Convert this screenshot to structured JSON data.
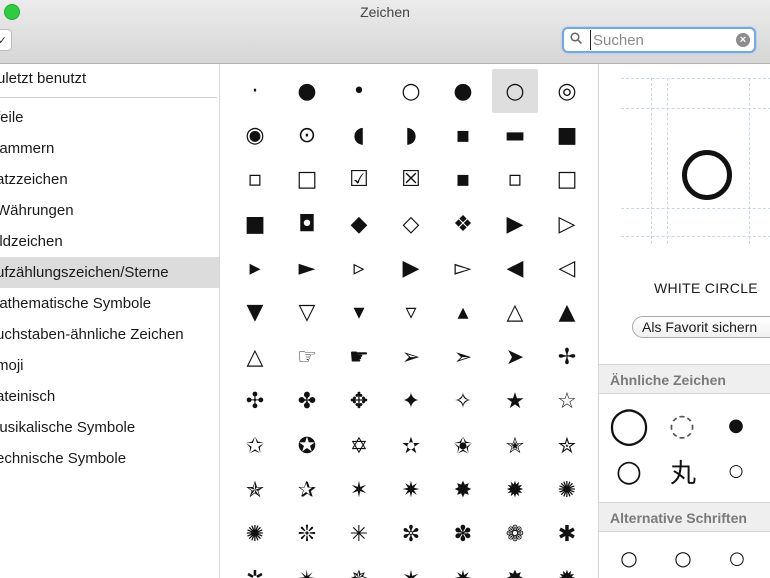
{
  "window": {
    "title": "Zeichen"
  },
  "toolbar": {
    "dropdown_glyph": "✓"
  },
  "search": {
    "placeholder": "Suchen",
    "value": ""
  },
  "sidebar": {
    "recent_label": "uletzt benutzt",
    "categories": [
      "feile",
      "lammern",
      "atzzeichen",
      "Währungen",
      "ildzeichen",
      "ufzählungszeichen/Sterne",
      "lathematische Symbole",
      "uchstaben-ähnliche Zeichen",
      "moji",
      "ateinisch",
      "lusikalische Symbole",
      "echnische Symbole"
    ],
    "selected_index": 5
  },
  "grid": {
    "selected_index": 5,
    "glyphs": [
      "·",
      "●",
      "•",
      "○",
      "●",
      "○",
      "◎",
      "◉",
      "⊙",
      "◖",
      "◗",
      "▪",
      "▬",
      "■",
      "▫",
      "□",
      "☑",
      "☒",
      "▪",
      "▫",
      "□",
      "■",
      "◘",
      "◆",
      "◇",
      "❖",
      "▶",
      "▷",
      "▸",
      "►",
      "▹",
      "▶",
      "▻",
      "◀",
      "◁",
      "▼",
      "▽",
      "▾",
      "▿",
      "▴",
      "△",
      "▲",
      "△",
      "☞",
      "☛",
      "➢",
      "➣",
      "➤",
      "✢",
      "✣",
      "✤",
      "✥",
      "✦",
      "✧",
      "★",
      "☆",
      "✩",
      "✪",
      "✡",
      "✫",
      "✬",
      "✭",
      "✮",
      "✯",
      "✰",
      "✶",
      "✷",
      "✸",
      "✹",
      "✺",
      "✺",
      "❊",
      "✳",
      "✼",
      "✽",
      "❁",
      "✱",
      "✲",
      "✴",
      "✵",
      "✶",
      "✷",
      "✸",
      "✹"
    ]
  },
  "detail": {
    "char_name": "WHITE CIRCLE",
    "favorite_label": "Als Favorit sichern",
    "similar_label": "Ähnliche Zeichen",
    "alt_fonts_label": "Alternative Schriften",
    "similar_glyphs": [
      "◯",
      "◌",
      "●",
      "○",
      "丸",
      "○"
    ],
    "alt_glyphs": [
      "○",
      "○",
      "○"
    ]
  }
}
